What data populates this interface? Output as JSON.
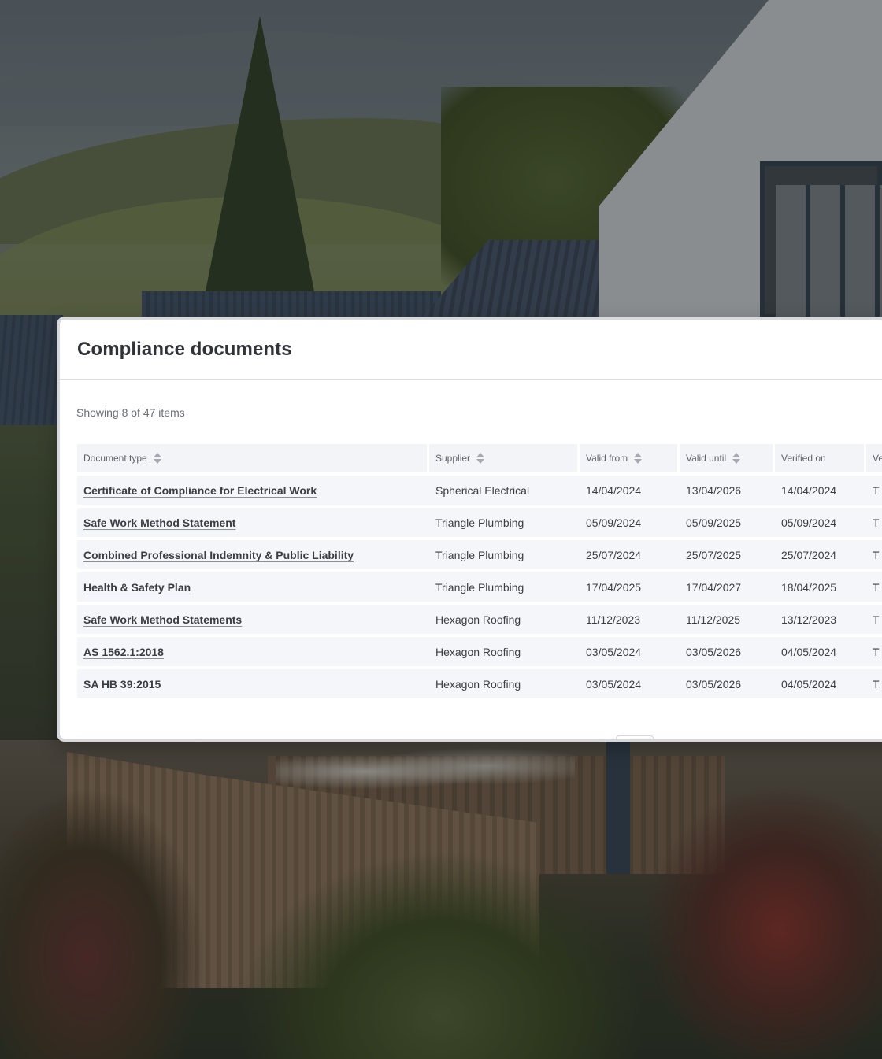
{
  "panel": {
    "title": "Compliance documents",
    "summary": "Showing 8 of 47 items"
  },
  "table": {
    "columns": [
      {
        "label": "Document type",
        "sortable": true
      },
      {
        "label": "Supplier",
        "sortable": true
      },
      {
        "label": "Valid from",
        "sortable": true
      },
      {
        "label": "Valid until",
        "sortable": true
      },
      {
        "label": "Verified on",
        "sortable": false
      },
      {
        "label": "Ve",
        "sortable": false
      }
    ],
    "rows": [
      {
        "document": "Certificate of Compliance for Electrical Work",
        "supplier": "Spherical Electrical",
        "valid_from": "14/04/2024",
        "valid_until": "13/04/2026",
        "verified_on": "14/04/2024",
        "verified_by": "T"
      },
      {
        "document": "Safe Work Method Statement",
        "supplier": "Triangle Plumbing",
        "valid_from": "05/09/2024",
        "valid_until": "05/09/2025",
        "verified_on": "05/09/2024",
        "verified_by": "T"
      },
      {
        "document": "Combined Professional Indemnity & Public Liability",
        "supplier": "Triangle Plumbing",
        "valid_from": "25/07/2024",
        "valid_until": "25/07/2025",
        "verified_on": "25/07/2024",
        "verified_by": "T"
      },
      {
        "document": "Health & Safety Plan",
        "supplier": "Triangle Plumbing",
        "valid_from": "17/04/2025",
        "valid_until": "17/04/2027",
        "verified_on": "18/04/2025",
        "verified_by": "T"
      },
      {
        "document": "Safe Work Method Statements",
        "supplier": "Hexagon Roofing",
        "valid_from": "11/12/2023",
        "valid_until": "11/12/2025",
        "verified_on": "13/12/2023",
        "verified_by": "T"
      },
      {
        "document": "AS 1562.1:2018",
        "supplier": "Hexagon Roofing",
        "valid_from": "03/05/2024",
        "valid_until": "03/05/2026",
        "verified_on": "04/05/2024",
        "verified_by": "T"
      },
      {
        "document": "SA HB 39:2015",
        "supplier": "Hexagon Roofing",
        "valid_from": "03/05/2024",
        "valid_until": "03/05/2026",
        "verified_on": "04/05/2024",
        "verified_by": "T"
      }
    ]
  },
  "icons": {
    "sort": "sort-icon"
  }
}
